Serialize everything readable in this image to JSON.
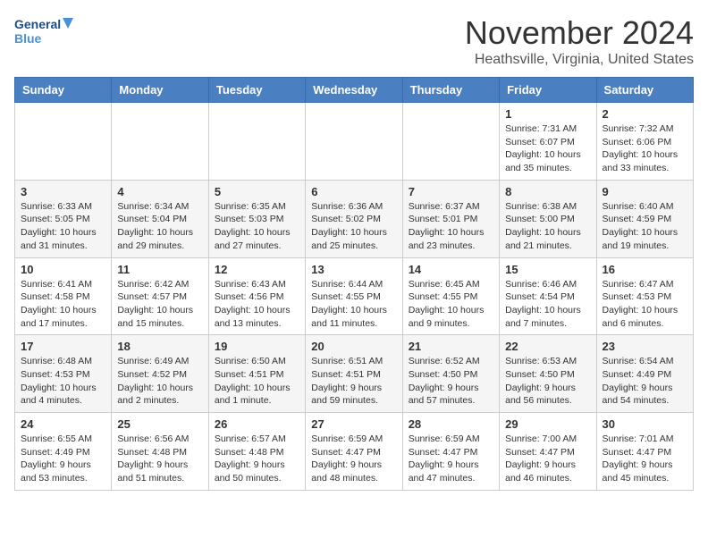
{
  "header": {
    "logo_line1": "General",
    "logo_line2": "Blue",
    "month": "November 2024",
    "location": "Heathsville, Virginia, United States"
  },
  "days_of_week": [
    "Sunday",
    "Monday",
    "Tuesday",
    "Wednesday",
    "Thursday",
    "Friday",
    "Saturday"
  ],
  "weeks": [
    [
      {
        "day": "",
        "info": ""
      },
      {
        "day": "",
        "info": ""
      },
      {
        "day": "",
        "info": ""
      },
      {
        "day": "",
        "info": ""
      },
      {
        "day": "",
        "info": ""
      },
      {
        "day": "1",
        "info": "Sunrise: 7:31 AM\nSunset: 6:07 PM\nDaylight: 10 hours and 35 minutes."
      },
      {
        "day": "2",
        "info": "Sunrise: 7:32 AM\nSunset: 6:06 PM\nDaylight: 10 hours and 33 minutes."
      }
    ],
    [
      {
        "day": "3",
        "info": "Sunrise: 6:33 AM\nSunset: 5:05 PM\nDaylight: 10 hours and 31 minutes."
      },
      {
        "day": "4",
        "info": "Sunrise: 6:34 AM\nSunset: 5:04 PM\nDaylight: 10 hours and 29 minutes."
      },
      {
        "day": "5",
        "info": "Sunrise: 6:35 AM\nSunset: 5:03 PM\nDaylight: 10 hours and 27 minutes."
      },
      {
        "day": "6",
        "info": "Sunrise: 6:36 AM\nSunset: 5:02 PM\nDaylight: 10 hours and 25 minutes."
      },
      {
        "day": "7",
        "info": "Sunrise: 6:37 AM\nSunset: 5:01 PM\nDaylight: 10 hours and 23 minutes."
      },
      {
        "day": "8",
        "info": "Sunrise: 6:38 AM\nSunset: 5:00 PM\nDaylight: 10 hours and 21 minutes."
      },
      {
        "day": "9",
        "info": "Sunrise: 6:40 AM\nSunset: 4:59 PM\nDaylight: 10 hours and 19 minutes."
      }
    ],
    [
      {
        "day": "10",
        "info": "Sunrise: 6:41 AM\nSunset: 4:58 PM\nDaylight: 10 hours and 17 minutes."
      },
      {
        "day": "11",
        "info": "Sunrise: 6:42 AM\nSunset: 4:57 PM\nDaylight: 10 hours and 15 minutes."
      },
      {
        "day": "12",
        "info": "Sunrise: 6:43 AM\nSunset: 4:56 PM\nDaylight: 10 hours and 13 minutes."
      },
      {
        "day": "13",
        "info": "Sunrise: 6:44 AM\nSunset: 4:55 PM\nDaylight: 10 hours and 11 minutes."
      },
      {
        "day": "14",
        "info": "Sunrise: 6:45 AM\nSunset: 4:55 PM\nDaylight: 10 hours and 9 minutes."
      },
      {
        "day": "15",
        "info": "Sunrise: 6:46 AM\nSunset: 4:54 PM\nDaylight: 10 hours and 7 minutes."
      },
      {
        "day": "16",
        "info": "Sunrise: 6:47 AM\nSunset: 4:53 PM\nDaylight: 10 hours and 6 minutes."
      }
    ],
    [
      {
        "day": "17",
        "info": "Sunrise: 6:48 AM\nSunset: 4:53 PM\nDaylight: 10 hours and 4 minutes."
      },
      {
        "day": "18",
        "info": "Sunrise: 6:49 AM\nSunset: 4:52 PM\nDaylight: 10 hours and 2 minutes."
      },
      {
        "day": "19",
        "info": "Sunrise: 6:50 AM\nSunset: 4:51 PM\nDaylight: 10 hours and 1 minute."
      },
      {
        "day": "20",
        "info": "Sunrise: 6:51 AM\nSunset: 4:51 PM\nDaylight: 9 hours and 59 minutes."
      },
      {
        "day": "21",
        "info": "Sunrise: 6:52 AM\nSunset: 4:50 PM\nDaylight: 9 hours and 57 minutes."
      },
      {
        "day": "22",
        "info": "Sunrise: 6:53 AM\nSunset: 4:50 PM\nDaylight: 9 hours and 56 minutes."
      },
      {
        "day": "23",
        "info": "Sunrise: 6:54 AM\nSunset: 4:49 PM\nDaylight: 9 hours and 54 minutes."
      }
    ],
    [
      {
        "day": "24",
        "info": "Sunrise: 6:55 AM\nSunset: 4:49 PM\nDaylight: 9 hours and 53 minutes."
      },
      {
        "day": "25",
        "info": "Sunrise: 6:56 AM\nSunset: 4:48 PM\nDaylight: 9 hours and 51 minutes."
      },
      {
        "day": "26",
        "info": "Sunrise: 6:57 AM\nSunset: 4:48 PM\nDaylight: 9 hours and 50 minutes."
      },
      {
        "day": "27",
        "info": "Sunrise: 6:59 AM\nSunset: 4:47 PM\nDaylight: 9 hours and 48 minutes."
      },
      {
        "day": "28",
        "info": "Sunrise: 6:59 AM\nSunset: 4:47 PM\nDaylight: 9 hours and 47 minutes."
      },
      {
        "day": "29",
        "info": "Sunrise: 7:00 AM\nSunset: 4:47 PM\nDaylight: 9 hours and 46 minutes."
      },
      {
        "day": "30",
        "info": "Sunrise: 7:01 AM\nSunset: 4:47 PM\nDaylight: 9 hours and 45 minutes."
      }
    ]
  ]
}
